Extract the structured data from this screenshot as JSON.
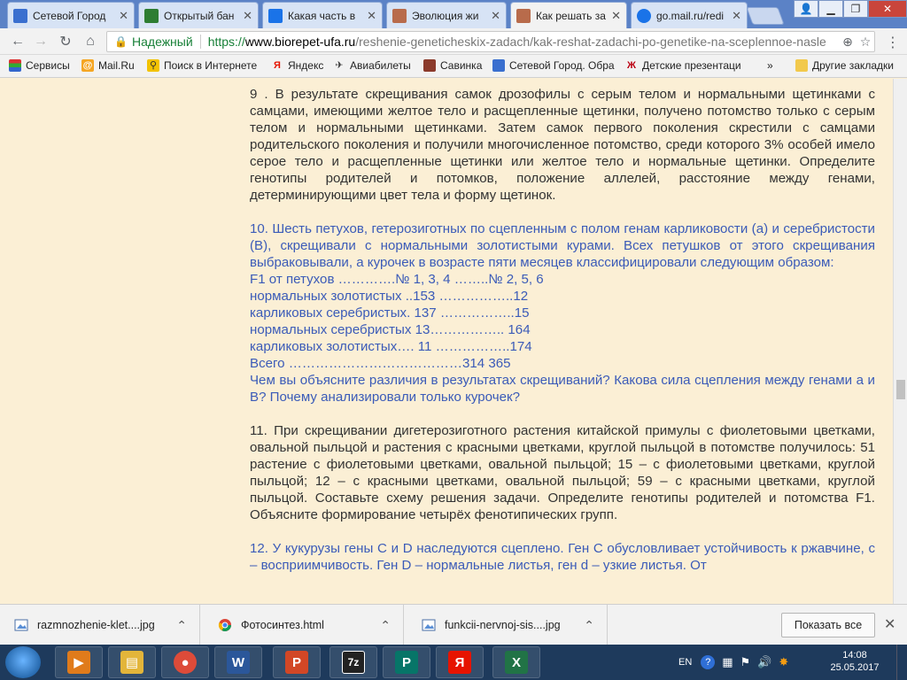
{
  "tabs": [
    {
      "title": "Сетевой Город",
      "fav_color": "#3a6fcf",
      "active": false
    },
    {
      "title": "Открытый бан",
      "fav_color": "#2e7d32",
      "active": false
    },
    {
      "title": "Какая часть в",
      "fav_color": "#1a73e8",
      "active": false
    },
    {
      "title": "Эволюция жи",
      "fav_color": "#b86b4b",
      "active": false
    },
    {
      "title": "Как решать за",
      "fav_color": "#b86b4b",
      "active": true
    },
    {
      "title": "go.mail.ru/redi",
      "fav_color": "#1a73e8",
      "active": false
    }
  ],
  "toolbar": {
    "secure_label": "Надежный",
    "url_scheme": "https://",
    "url_host": "www.biorepet-ufa.ru",
    "url_path": "/reshenie-geneticheskix-zadach/kak-reshat-zadachi-po-genetike-na-sceplennoe-nasle"
  },
  "bookmarks": [
    {
      "label": "Сервисы",
      "icon": "apps-icon"
    },
    {
      "label": "Mail.Ru",
      "icon": "mailru-icon"
    },
    {
      "label": "Поиск в Интернете",
      "icon": "search-icon"
    },
    {
      "label": "Яндекс",
      "icon": "yandex-icon"
    },
    {
      "label": "Авиабилеты",
      "icon": "plane-icon"
    },
    {
      "label": "Савинка",
      "icon": "folder-icon"
    },
    {
      "label": "Сетевой Город. Обра",
      "icon": "network-city-icon"
    },
    {
      "label": "Детские презентаци",
      "icon": "presentation-icon"
    },
    {
      "label": "»",
      "icon": "more-icon"
    },
    {
      "label": "Другие закладки",
      "icon": "folder-icon"
    }
  ],
  "content": {
    "p9": [
      "9 . В результате скрещивания самок дрозофилы с серым телом и нормальными щетинками с самцами, имеющими желтое тело и расщепленные щетинки, получено потомство только с серым телом и нормальными щетинками. Затем самок первого поколения скрестили с самцами родительского поколения и получили многочисленное потомство, среди которого 3% особей имело серое тело и расщепленные щетинки или желтое тело и нормальные щетинки. Определите генотипы родителей и потомков, положение аллелей, расстояние между генами, детерминирующими цвет тела и форму щетинок."
    ],
    "p10_text": "10. Шесть петухов, гетерозиготных по сцепленным с полом генам карликовости (а) и серебристости (В), скрещивали с нормальными золотистыми курами. Всех петушков от этого скрещивания выбраковывали, а курочек в возрасте пяти месяцев классифицировали следующим образом:",
    "p10_lines": [
      "F1 от петухов ………….№ 1, 3, 4 ……..№ 2, 5, 6",
      "нормальных золотистых ..153 ……………..12",
      "карликовых серебристых. 137 ……………..15",
      "нормальных серебристых 13…………….. 164",
      "карликовых золотистых…. 11 ……………..174",
      "Всего …………………………………314 365"
    ],
    "p10_question": "Чем вы объясните различия в результатах скрещиваний? Какова сила сцепления между генами а и В? Почему анализировали только курочек?",
    "p11": "11. При скрещивании дигетерозиготного растения китайской примулы с фиолетовыми цветками, овальной пыльцой и растения с красными цветками, круглой пыльцой в потомстве получилось: 51 растение с фиолетовыми цветками, овальной пыльцой; 15 – с фиолетовыми цветками, круглой пыльцой; 12 – с красными цветками, овальной пыльцой; 59 – с красными цветками, круглой пыльцой. Составьте схему решения задачи. Определите генотипы родителей и потомства F1. Объясните формирование четырёх фенотипических групп.",
    "p12": "12. У кукурузы гены С и D наследуются сцеплено. Ген С обусловливает устойчивость к ржавчине, с – восприимчивость. Ген D – нормальные листья, ген d – узкие листья. От"
  },
  "downloads": [
    {
      "name": "razmnozhenie-klet....jpg",
      "icon": "image-file-icon"
    },
    {
      "name": "Фотосинтез.html",
      "icon": "chrome-icon"
    },
    {
      "name": "funkcii-nervnoj-sis....jpg",
      "icon": "image-file-icon"
    }
  ],
  "download_bar": {
    "show_all": "Показать все"
  },
  "taskbar": {
    "apps": [
      {
        "name": "media-player",
        "glyph": "▶",
        "color": "#e07b1b"
      },
      {
        "name": "explorer",
        "glyph": "▤",
        "color": "#e3b53a"
      },
      {
        "name": "chrome",
        "glyph": "●",
        "color": "#dd4b39"
      },
      {
        "name": "word",
        "glyph": "W",
        "color": "#2b579a"
      },
      {
        "name": "powerpoint",
        "glyph": "P",
        "color": "#d24726"
      },
      {
        "name": "7zip",
        "glyph": "7z",
        "color": "#222222"
      },
      {
        "name": "publisher",
        "glyph": "P",
        "color": "#077568"
      },
      {
        "name": "yandex-browser",
        "glyph": "Я",
        "color": "#e61400"
      },
      {
        "name": "excel",
        "glyph": "X",
        "color": "#217346"
      }
    ],
    "lang": "EN",
    "time": "14:08",
    "date": "25.05.2017"
  }
}
